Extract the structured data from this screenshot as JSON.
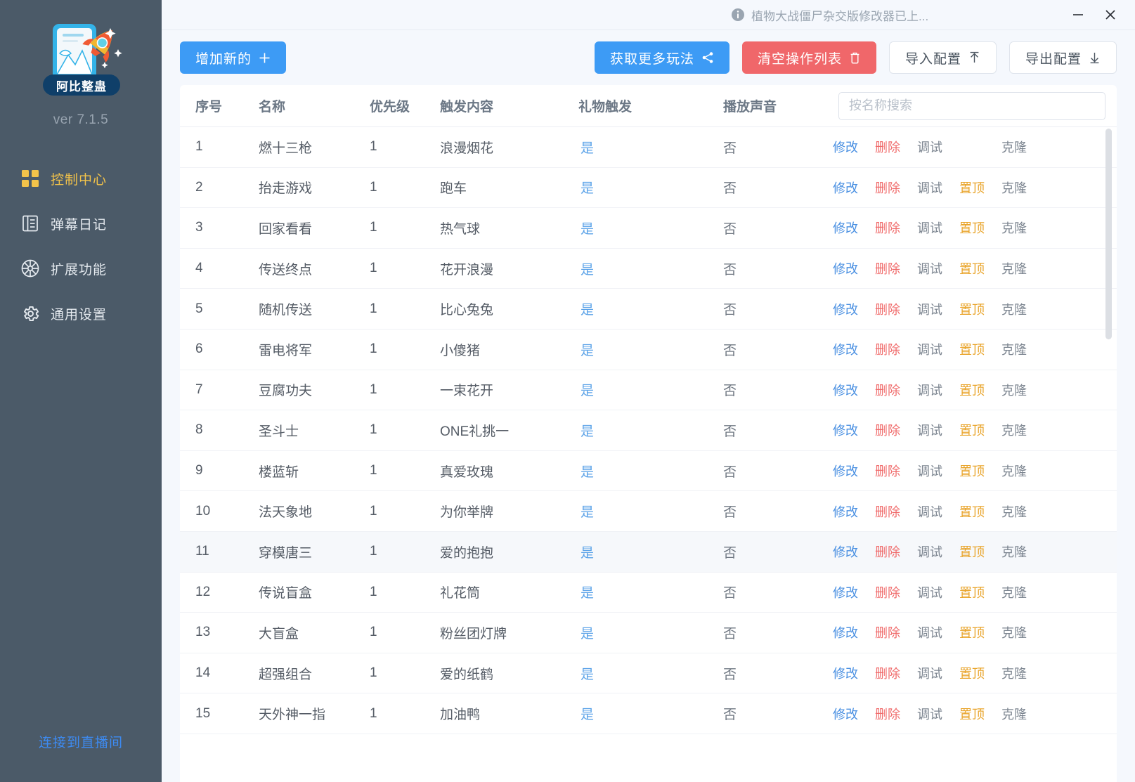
{
  "sidebar": {
    "logo_label": "阿比整蛊",
    "version": "ver 7.1.5",
    "items": [
      {
        "label": "控制中心",
        "icon": "grid-icon",
        "active": true
      },
      {
        "label": "弹幕日记",
        "icon": "book-icon",
        "active": false
      },
      {
        "label": "扩展功能",
        "icon": "plugin-icon",
        "active": false
      },
      {
        "label": "通用设置",
        "icon": "gear-icon",
        "active": false
      }
    ],
    "connect_label": "连接到直播间",
    "bg_color": "#4b5a68",
    "active_color": "#f3c34a",
    "link_color": "#3d8bf2"
  },
  "titlebar": {
    "notice": "植物大战僵尸杂交版修改器已上...",
    "minimize_label": "最小化",
    "close_label": "关闭"
  },
  "toolbar": {
    "add_new": "增加新的",
    "add_new_icon": "plus-icon",
    "get_more": "获取更多玩法",
    "get_more_icon": "share-icon",
    "clear_list": "清空操作列表",
    "clear_list_icon": "trash-icon",
    "import_config": "导入配置",
    "import_icon": "arrow-up-icon",
    "export_config": "导出配置",
    "export_icon": "arrow-down-icon",
    "blue": "#3d9bf5",
    "red": "#f0676a"
  },
  "table": {
    "headers": {
      "index": "序号",
      "name": "名称",
      "priority": "优先级",
      "trigger": "触发内容",
      "gift": "礼物触发",
      "sound": "播放声音"
    },
    "search_placeholder": "按名称搜索",
    "search_value": "",
    "actions": {
      "edit": "修改",
      "delete": "删除",
      "debug": "调试",
      "top": "置顶",
      "clone": "克隆"
    },
    "rows": [
      {
        "index": "1",
        "name": "燃十三枪",
        "priority": "1",
        "trigger": "浪漫烟花",
        "gift": "是",
        "sound": "否",
        "has_top": false,
        "hover": false
      },
      {
        "index": "2",
        "name": "抬走游戏",
        "priority": "1",
        "trigger": "跑车",
        "gift": "是",
        "sound": "否",
        "has_top": true,
        "hover": false
      },
      {
        "index": "3",
        "name": "回家看看",
        "priority": "1",
        "trigger": "热气球",
        "gift": "是",
        "sound": "否",
        "has_top": true,
        "hover": false
      },
      {
        "index": "4",
        "name": "传送终点",
        "priority": "1",
        "trigger": "花开浪漫",
        "gift": "是",
        "sound": "否",
        "has_top": true,
        "hover": false
      },
      {
        "index": "5",
        "name": "随机传送",
        "priority": "1",
        "trigger": "比心兔兔",
        "gift": "是",
        "sound": "否",
        "has_top": true,
        "hover": false
      },
      {
        "index": "6",
        "name": "雷电将军",
        "priority": "1",
        "trigger": "小傻猪",
        "gift": "是",
        "sound": "否",
        "has_top": true,
        "hover": false
      },
      {
        "index": "7",
        "name": "豆腐功夫",
        "priority": "1",
        "trigger": "一束花开",
        "gift": "是",
        "sound": "否",
        "has_top": true,
        "hover": false
      },
      {
        "index": "8",
        "name": "圣斗士",
        "priority": "1",
        "trigger": "ONE礼挑一",
        "gift": "是",
        "sound": "否",
        "has_top": true,
        "hover": false
      },
      {
        "index": "9",
        "name": "楼蓝斩",
        "priority": "1",
        "trigger": "真爱玫瑰",
        "gift": "是",
        "sound": "否",
        "has_top": true,
        "hover": false
      },
      {
        "index": "10",
        "name": "法天象地",
        "priority": "1",
        "trigger": "为你举牌",
        "gift": "是",
        "sound": "否",
        "has_top": true,
        "hover": false
      },
      {
        "index": "11",
        "name": "穿模唐三",
        "priority": "1",
        "trigger": "爱的抱抱",
        "gift": "是",
        "sound": "否",
        "has_top": true,
        "hover": true
      },
      {
        "index": "12",
        "name": "传说盲盒",
        "priority": "1",
        "trigger": "礼花筒",
        "gift": "是",
        "sound": "否",
        "has_top": true,
        "hover": false
      },
      {
        "index": "13",
        "name": "大盲盒",
        "priority": "1",
        "trigger": "粉丝团灯牌",
        "gift": "是",
        "sound": "否",
        "has_top": true,
        "hover": false
      },
      {
        "index": "14",
        "name": "超强组合",
        "priority": "1",
        "trigger": "爱的纸鹤",
        "gift": "是",
        "sound": "否",
        "has_top": true,
        "hover": false
      },
      {
        "index": "15",
        "name": "天外神一指",
        "priority": "1",
        "trigger": "加油鸭",
        "gift": "是",
        "sound": "否",
        "has_top": true,
        "hover": false
      }
    ]
  }
}
